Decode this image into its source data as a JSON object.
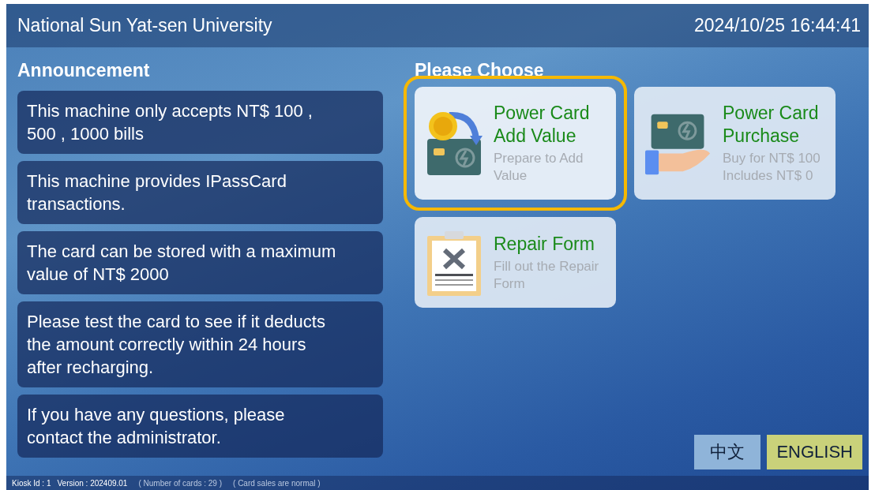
{
  "header": {
    "title": "National Sun Yat-sen University",
    "datetime": "2024/10/25 16:44:41"
  },
  "announcement": {
    "heading": "Announcement",
    "items": [
      "This machine only accepts NT$ 100 , 500 , 1000 bills",
      "This machine provides IPassCard transactions.",
      "The card can be stored with a maximum value of NT$ 2000",
      "Please test the card to see if it deducts the amount correctly within 24 hours after recharging.",
      "If you have any questions, please contact the administrator."
    ]
  },
  "menu": {
    "heading": "Please Choose",
    "options": [
      {
        "kind": "add-value",
        "title": "Power Card Add Value",
        "subtitle": [
          "Prepare to Add Value"
        ],
        "selected": true
      },
      {
        "kind": "purchase",
        "title": "Power Card Purchase",
        "subtitle": [
          "Buy for NT$ 100",
          "Includes NT$ 0"
        ],
        "selected": false
      },
      {
        "kind": "repair",
        "title": "Repair Form",
        "subtitle": [
          "Fill out the Repair Form"
        ],
        "selected": false
      }
    ]
  },
  "languages": [
    {
      "label": "中文",
      "selected": false
    },
    {
      "label": "ENGLISH",
      "selected": true
    }
  ],
  "status_bar": {
    "kiosk": "Kiosk Id : 1",
    "version": "Version : 202409.01",
    "cards": "( Number of cards : 29 )",
    "sales": "( Card sales are normal )"
  }
}
